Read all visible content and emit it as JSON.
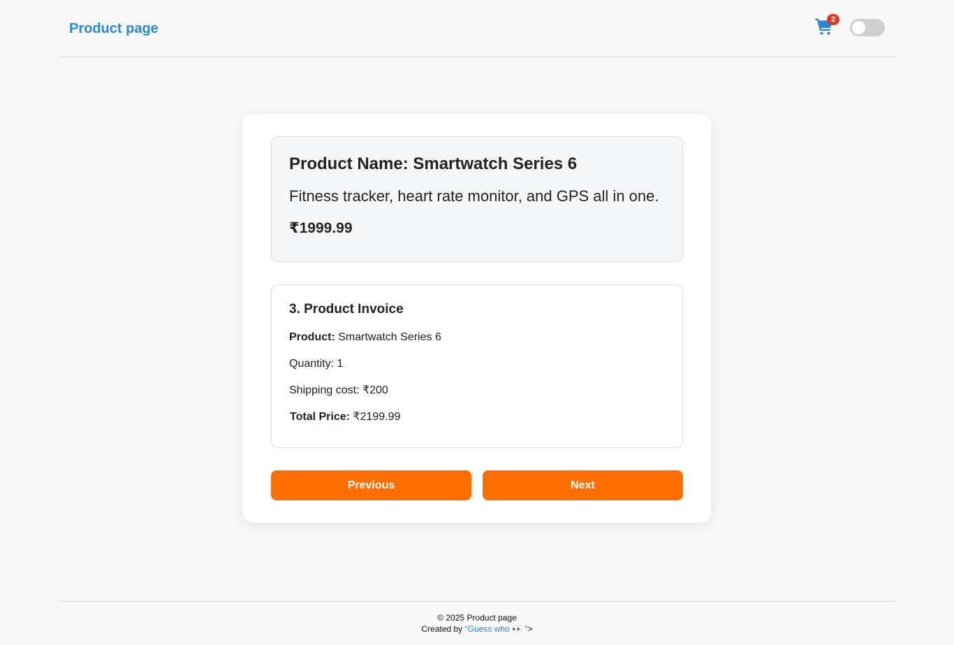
{
  "header": {
    "brand": "Product page",
    "cart_icon": "cart-icon",
    "cart_count": "2",
    "theme_toggle": "toggle-switch"
  },
  "product": {
    "name": "Product Name: Smartwatch Series 6",
    "description": "Fitness tracker, heart rate monitor, and GPS all in one.",
    "price": "₹1999.99"
  },
  "invoice": {
    "title": "3. Product Invoice",
    "product_label": "Product:",
    "product_value": "Smartwatch Series 6",
    "quantity": "Quantity: 1",
    "shipping": "Shipping cost: ₹200",
    "total_label": "Total Price:",
    "total_value": "₹2199.99"
  },
  "buttons": {
    "previous": "Previous",
    "next": "Next"
  },
  "footer": {
    "copyright": "© 2025 Product page",
    "credit_prefix": "Created by",
    "credit_link": "\"Guess who 👀 \"",
    "credit_suffix": ">"
  },
  "colors": {
    "brand": "#2b88d8",
    "accent": "#ff6f00",
    "badge": "#e03a1e"
  }
}
